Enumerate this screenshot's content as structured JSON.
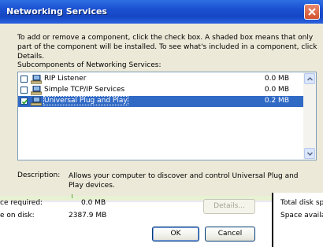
{
  "dialog": {
    "title": "Networking Services",
    "intro": "To add or remove a component, click the check box. A shaded box means that only part of the component will be installed. To see what's included in a component, click Details.",
    "subcomponents_label": "Subcomponents of Networking Services:",
    "items": [
      {
        "label": "RIP Listener",
        "size": "0.0 MB",
        "checked": false,
        "selected": false
      },
      {
        "label": "Simple TCP/IP Services",
        "size": "0.0 MB",
        "checked": false,
        "selected": false
      },
      {
        "label": "Universal Plug and Play",
        "size": "0.2 MB",
        "checked": true,
        "selected": true
      }
    ],
    "description_label": "Description:",
    "description_text": "Allows your computer to discover and control Universal Plug and Play devices.",
    "space_required_label": "ce required:",
    "space_required_value": "0.0 MB",
    "space_on_disk_label": "e on disk:",
    "space_on_disk_value": "2387.9 MB",
    "total_disk_label": "Total disk spa",
    "space_available_label": "Space availab",
    "details_button": "Details...",
    "ok_button": "OK",
    "cancel_button": "Cancel"
  },
  "colors": {
    "title_bar": "#1547c4",
    "selection": "#316ac5",
    "dialog_bg": "#ece9d8",
    "close_button": "#d4502c"
  },
  "icons": {
    "close": "close-icon",
    "component": "network-component-icon",
    "check": "checkmark-icon",
    "scroll_up": "scroll-up-arrow-icon",
    "scroll_down": "scroll-down-arrow-icon"
  }
}
